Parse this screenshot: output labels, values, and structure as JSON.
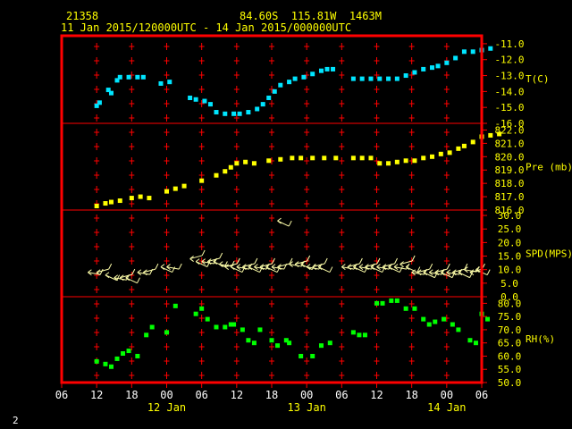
{
  "header": {
    "station": "21358",
    "location": "84.60S  115.81W  1463M",
    "time_range": "11 Jan 2015/120000UTC - 14 Jan 2015/000000UTC"
  },
  "footer": {
    "page": "2"
  },
  "colors": {
    "frame": "#ff0000",
    "ticks": "#ff0000",
    "labels": "#ffff00",
    "temp": "#00e5ff",
    "pres": "#ffff00",
    "wind": "#ffffaa",
    "rh": "#00ff00"
  },
  "chart_data": {
    "type": "scatter",
    "xlim": [
      -6,
      42
    ],
    "x_ticks": [
      -6,
      0,
      6,
      12,
      18,
      24,
      30,
      36,
      42
    ],
    "x_tick_labels": [
      "06",
      "12",
      "18",
      "00",
      "06",
      "12",
      "18",
      "00",
      "06",
      "12",
      "18",
      "00",
      "06"
    ],
    "x_tick_hours": [
      -6,
      0,
      6,
      12,
      18,
      24,
      30,
      36,
      42,
      48,
      54,
      60,
      66
    ],
    "x_date_labels": [
      {
        "hour": 12,
        "label": "12 Jan"
      },
      {
        "hour": 36,
        "label": "13 Jan"
      },
      {
        "hour": 60,
        "label": "14 Jan"
      }
    ],
    "xrange_hours": [
      -6,
      66
    ],
    "panels": [
      {
        "name": "T(C)",
        "ylim": [
          -16,
          -10.5
        ],
        "ticks": [
          -16,
          -15,
          -14,
          -13,
          -12,
          -11
        ],
        "tick_labels": [
          "-16.0",
          "-15.0",
          "-14.0",
          "-13.0",
          "-12.0",
          "-11.0"
        ],
        "series": [
          {
            "values": [
              [
                0,
                -14.9
              ],
              [
                0.5,
                -14.7
              ],
              [
                2,
                -13.9
              ],
              [
                2.5,
                -14.1
              ],
              [
                3.5,
                -13.3
              ],
              [
                4,
                -13.1
              ],
              [
                5.5,
                -13.1
              ],
              [
                7,
                -13.1
              ],
              [
                8,
                -13.1
              ],
              [
                11,
                -13.5
              ],
              [
                12.5,
                -13.4
              ],
              [
                16,
                -14.4
              ],
              [
                17,
                -14.5
              ],
              [
                18.5,
                -14.6
              ],
              [
                19.5,
                -14.8
              ],
              [
                20.5,
                -15.3
              ],
              [
                22,
                -15.4
              ],
              [
                23.5,
                -15.4
              ],
              [
                24.5,
                -15.4
              ],
              [
                26,
                -15.3
              ],
              [
                27.5,
                -15.1
              ],
              [
                28.5,
                -14.8
              ],
              [
                29.5,
                -14.4
              ],
              [
                30.5,
                -14
              ],
              [
                31.5,
                -13.6
              ],
              [
                33,
                -13.4
              ],
              [
                34,
                -13.2
              ],
              [
                35.5,
                -13.1
              ],
              [
                37,
                -12.9
              ],
              [
                38.5,
                -12.7
              ],
              [
                39.5,
                -12.6
              ],
              [
                40.5,
                -12.6
              ],
              [
                44,
                -13.2
              ],
              [
                45.5,
                -13.2
              ],
              [
                47,
                -13.2
              ],
              [
                48.5,
                -13.2
              ],
              [
                50,
                -13.2
              ],
              [
                51.5,
                -13.2
              ],
              [
                53,
                -13
              ],
              [
                54.5,
                -12.8
              ],
              [
                56,
                -12.6
              ],
              [
                57.5,
                -12.5
              ],
              [
                58.5,
                -12.4
              ],
              [
                60,
                -12.2
              ],
              [
                61.5,
                -11.9
              ],
              [
                63,
                -11.5
              ],
              [
                64.5,
                -11.5
              ],
              [
                66,
                -11.4
              ],
              [
                67.5,
                -11.3
              ]
            ]
          }
        ]
      },
      {
        "name": "Pre (mb)",
        "ylim": [
          816,
          822.5
        ],
        "ticks": [
          816,
          817,
          818,
          819,
          820,
          821,
          822
        ],
        "tick_labels": [
          "816.0",
          "817.0",
          "818.0",
          "819.0",
          "820.0",
          "821.0",
          "822.0"
        ],
        "series": [
          {
            "values": [
              [
                0,
                816.3
              ],
              [
                1.5,
                816.5
              ],
              [
                2.5,
                816.6
              ],
              [
                4,
                816.7
              ],
              [
                6,
                816.9
              ],
              [
                7.5,
                817.0
              ],
              [
                9,
                816.9
              ],
              [
                12,
                817.4
              ],
              [
                13.5,
                817.6
              ],
              [
                15,
                817.8
              ],
              [
                18,
                818.2
              ],
              [
                20.5,
                818.6
              ],
              [
                22,
                818.9
              ],
              [
                23,
                819.2
              ],
              [
                24,
                819.5
              ],
              [
                25.5,
                819.6
              ],
              [
                27,
                819.5
              ],
              [
                29.5,
                819.7
              ],
              [
                31.5,
                819.8
              ],
              [
                33.5,
                819.9
              ],
              [
                35,
                819.9
              ],
              [
                37,
                819.9
              ],
              [
                39,
                819.9
              ],
              [
                41,
                819.9
              ],
              [
                44,
                819.9
              ],
              [
                45.5,
                819.9
              ],
              [
                47,
                819.9
              ],
              [
                48.5,
                819.5
              ],
              [
                50,
                819.5
              ],
              [
                51.5,
                819.6
              ],
              [
                53,
                819.7
              ],
              [
                54.5,
                819.7
              ],
              [
                56,
                819.9
              ],
              [
                57.5,
                820
              ],
              [
                59,
                820.2
              ],
              [
                60.5,
                820.3
              ],
              [
                62,
                820.6
              ],
              [
                63,
                820.8
              ],
              [
                64.5,
                821.1
              ],
              [
                66,
                821.5
              ],
              [
                67.5,
                821.6
              ],
              [
                69,
                821.7
              ]
            ]
          }
        ]
      },
      {
        "name": "SPD(MPS)",
        "ylim": [
          0,
          32
        ],
        "ticks": [
          0,
          5,
          10,
          15,
          20,
          25,
          30
        ],
        "tick_labels": [
          "0.0",
          "5.0",
          "10.0",
          "15.0",
          "20.0",
          "25.0",
          "30.0"
        ],
        "series": [
          {
            "values": [
              [
                -1.5,
                9
              ],
              [
                0,
                9
              ],
              [
                1.5,
                8
              ],
              [
                3,
                7
              ],
              [
                4,
                7
              ],
              [
                5,
                7
              ],
              [
                7,
                9
              ],
              [
                8,
                9
              ],
              [
                11,
                11
              ],
              [
                12,
                11
              ],
              [
                16,
                14
              ],
              [
                17,
                13
              ],
              [
                18,
                13
              ],
              [
                19,
                13
              ],
              [
                20,
                13
              ],
              [
                21,
                12
              ],
              [
                22,
                11
              ],
              [
                23,
                11
              ],
              [
                24,
                11
              ],
              [
                25,
                11
              ],
              [
                26,
                11
              ],
              [
                27,
                11
              ],
              [
                28,
                11
              ],
              [
                29,
                11
              ],
              [
                30,
                11
              ],
              [
                31,
                11
              ],
              [
                31,
                28
              ],
              [
                33,
                12
              ],
              [
                34,
                12
              ],
              [
                35,
                12
              ],
              [
                36,
                11
              ],
              [
                37,
                11
              ],
              [
                38,
                11
              ],
              [
                42,
                11
              ],
              [
                43,
                11
              ],
              [
                44,
                11
              ],
              [
                45,
                11
              ],
              [
                46,
                11
              ],
              [
                47,
                11
              ],
              [
                48,
                11
              ],
              [
                49,
                11
              ],
              [
                50,
                11
              ],
              [
                51,
                11
              ],
              [
                52,
                12
              ],
              [
                53,
                11
              ],
              [
                54,
                9
              ],
              [
                55,
                9
              ],
              [
                56,
                9
              ],
              [
                57,
                9
              ],
              [
                58,
                9
              ],
              [
                59,
                9
              ],
              [
                60,
                9
              ],
              [
                61,
                9
              ],
              [
                62,
                9
              ],
              [
                63,
                10
              ],
              [
                64,
                9
              ],
              [
                65,
                10
              ]
            ]
          }
        ]
      },
      {
        "name": "RH(%)",
        "ylim": [
          50,
          82.5
        ],
        "ticks": [
          50,
          55,
          60,
          65,
          70,
          75,
          80
        ],
        "tick_labels": [
          "50.0",
          "55.0",
          "60.0",
          "65.0",
          "70.0",
          "75.0",
          "80.0"
        ],
        "series": [
          {
            "values": [
              [
                0,
                58
              ],
              [
                1.5,
                57
              ],
              [
                2.5,
                56
              ],
              [
                3.5,
                59
              ],
              [
                4.5,
                61
              ],
              [
                5.5,
                62
              ],
              [
                7,
                60
              ],
              [
                8.5,
                68
              ],
              [
                9.5,
                71
              ],
              [
                12,
                69
              ],
              [
                13.5,
                79
              ],
              [
                17,
                76
              ],
              [
                18,
                78
              ],
              [
                19,
                74
              ],
              [
                20.5,
                71
              ],
              [
                22,
                71
              ],
              [
                23,
                72
              ],
              [
                23.5,
                72
              ],
              [
                25,
                70
              ],
              [
                26,
                66
              ],
              [
                27,
                65
              ],
              [
                28,
                70
              ],
              [
                30,
                66
              ],
              [
                31,
                64
              ],
              [
                32.5,
                66
              ],
              [
                33,
                65
              ],
              [
                35,
                60
              ],
              [
                37,
                60
              ],
              [
                38.5,
                64
              ],
              [
                40,
                65
              ],
              [
                44,
                69
              ],
              [
                45,
                68
              ],
              [
                46,
                68
              ],
              [
                48,
                80
              ],
              [
                49,
                80
              ],
              [
                50.5,
                81
              ],
              [
                51.5,
                81
              ],
              [
                53,
                78
              ],
              [
                54.5,
                78
              ],
              [
                56,
                74
              ],
              [
                57,
                72
              ],
              [
                58,
                73
              ],
              [
                59.5,
                74
              ],
              [
                61,
                72
              ],
              [
                62,
                70
              ],
              [
                64,
                66
              ],
              [
                65,
                65
              ],
              [
                66,
                76
              ],
              [
                67,
                74
              ]
            ]
          }
        ]
      }
    ],
    "annotation_arrow": [
      31,
      28
    ]
  }
}
